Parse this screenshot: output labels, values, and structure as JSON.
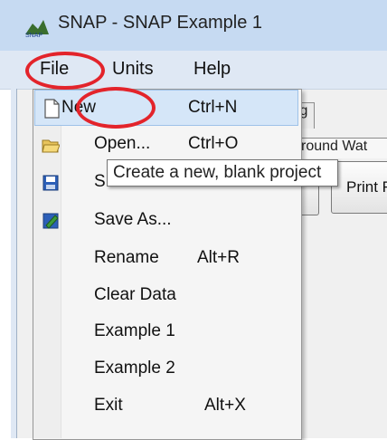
{
  "window": {
    "title": "SNAP - SNAP Example 1"
  },
  "menubar": {
    "file": "File",
    "units": "Units",
    "help": "Help"
  },
  "file_menu": {
    "items": [
      {
        "label": "New",
        "shortcut": "Ctrl+N",
        "icon": "new-document-icon",
        "highlighted": true
      },
      {
        "label": "Open...",
        "shortcut": "Ctrl+O",
        "icon": "open-folder-icon"
      },
      {
        "label": "S",
        "shortcut": "",
        "icon": "save-icon"
      },
      {
        "label": "Save As...",
        "shortcut": "",
        "icon": "save-as-icon"
      },
      {
        "label": "Rename",
        "shortcut": "Alt+R"
      },
      {
        "label": "Clear Data",
        "shortcut": ""
      },
      {
        "label": "Example 1",
        "shortcut": ""
      },
      {
        "label": "Example 2",
        "shortcut": ""
      },
      {
        "label": "Exit",
        "shortcut": "Alt+X"
      }
    ]
  },
  "tooltip": {
    "text": "Create a new, blank project"
  },
  "background": {
    "tab_partial": "g",
    "groundwater_tab": "round Wat",
    "print_button": "Print F"
  },
  "colors": {
    "highlight": "#d5e6f8",
    "annotation_red": "#e3242b",
    "titlebar": "#c6daf2"
  }
}
